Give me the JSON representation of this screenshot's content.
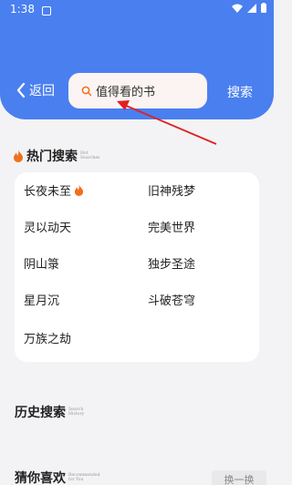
{
  "status_bar": {
    "time": "1:38"
  },
  "header": {
    "back_label": "返回",
    "search_placeholder": "值得看的书",
    "search_button": "搜索"
  },
  "hot_search": {
    "title": "热门搜索",
    "subtitle": "Hot Searches",
    "items": [
      {
        "label": "长夜未至",
        "hot": true
      },
      {
        "label": "旧神残梦",
        "hot": false
      },
      {
        "label": "灵以动天",
        "hot": false
      },
      {
        "label": "完美世界",
        "hot": false
      },
      {
        "label": "阴山箓",
        "hot": false
      },
      {
        "label": "独步圣途",
        "hot": false
      },
      {
        "label": "星月沉",
        "hot": false
      },
      {
        "label": "斗破苍穹",
        "hot": false
      },
      {
        "label": "万族之劫",
        "hot": false
      }
    ]
  },
  "history": {
    "title": "历史搜索",
    "subtitle": "Search History"
  },
  "guess": {
    "title": "猜你喜欢",
    "subtitle": "Recommended for You",
    "refresh_label": "换一换"
  },
  "colors": {
    "header": "#4a7ff0",
    "flame": "#f0701e",
    "arrow": "#e02020"
  }
}
